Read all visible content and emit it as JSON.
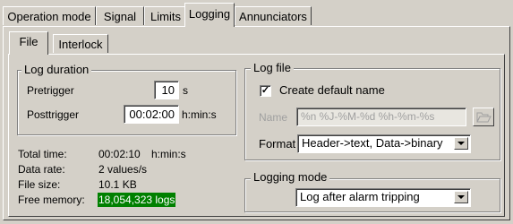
{
  "tabs": [
    "Operation mode",
    "Signal",
    "Limits",
    "Logging",
    "Annunciators"
  ],
  "active_tab": "Logging",
  "subtabs": [
    "File",
    "Interlock"
  ],
  "active_subtab": "File",
  "log_duration": {
    "title": "Log duration",
    "pretrigger_label": "Pretrigger",
    "pretrigger_value": "10",
    "pretrigger_unit": "s",
    "posttrigger_label": "Posttrigger",
    "posttrigger_value": "00:02:00",
    "posttrigger_unit": "h:min:s"
  },
  "stats": {
    "total_time_label": "Total time:",
    "total_time_value": "00:02:10",
    "total_time_unit": "h:min:s",
    "data_rate_label": "Data rate:",
    "data_rate_value": "2 values/s",
    "file_size_label": "File size:",
    "file_size_value": "10.1 KB",
    "free_memory_label": "Free memory:",
    "free_memory_value": "18,054,323 logs",
    "free_memory_color": "#008000"
  },
  "log_file": {
    "title": "Log file",
    "create_default_label": "Create default name",
    "create_default_checked": true,
    "check_mark": "✓",
    "name_label": "Name",
    "name_value": "%n %J-%M-%d %h-%m-%s",
    "format_label": "Format",
    "format_value": "Header->text, Data->binary"
  },
  "logging_mode": {
    "title": "Logging mode",
    "value": "Log after alarm tripping"
  }
}
